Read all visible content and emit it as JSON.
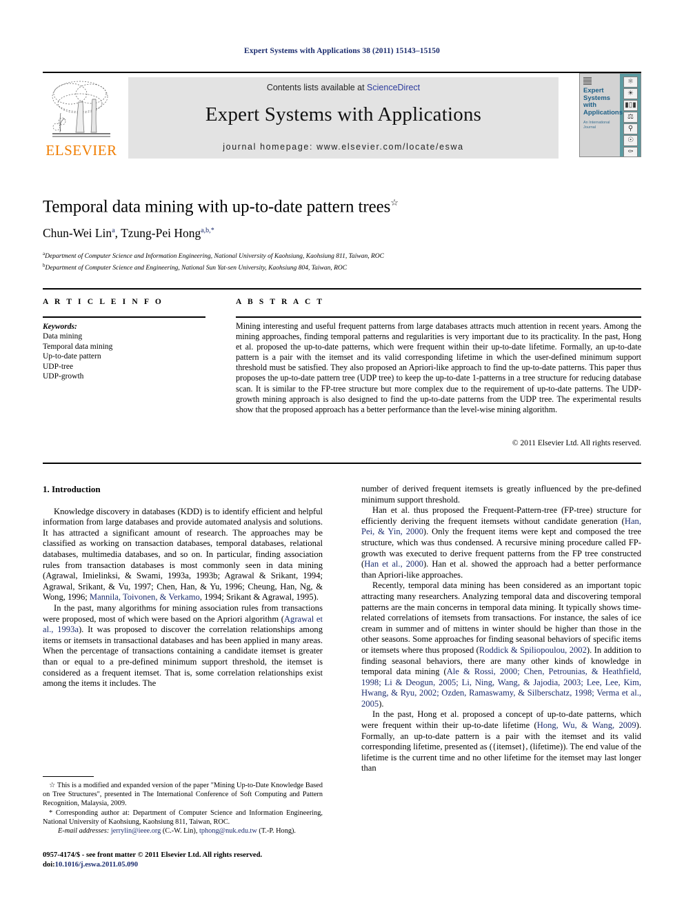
{
  "running_head": "Expert Systems with Applications 38 (2011) 15143–15150",
  "banner": {
    "contents_prefix": "Contents lists available at ",
    "sciencedirect": "ScienceDirect",
    "journal_title": "Expert Systems with Applications",
    "homepage_prefix": "journal homepage: ",
    "homepage_url": "www.elsevier.com/locate/eswa",
    "publisher": "ELSEVIER",
    "publisher_color": "#f07d00",
    "link_color": "#2b3a9c",
    "cover": {
      "name_line1": "Expert",
      "name_line2": "Systems",
      "name_line3": "with",
      "name_line4": "Applications",
      "subtitle_line1": "An International",
      "subtitle_line2": "Journal",
      "strip_color": "#5c9aa0",
      "icons": [
        "atom-icon",
        "globe-icon",
        "bar-chart-icon",
        "scales-icon",
        "document-icon",
        "microscope-icon",
        "network-icon",
        "flask-icon",
        "antenna-icon"
      ]
    }
  },
  "article": {
    "title": "Temporal data mining with up-to-date pattern trees",
    "title_footnote_marker": "☆",
    "authors": "Chun-Wei Lin",
    "author1_sup": "a",
    "author2": ", Tzung-Pei Hong",
    "author2_sup": "a,b,",
    "author2_star": "*",
    "affiliation_a_marker": "a",
    "affiliation_a": "Department of Computer Science and Information Engineering, National University of Kaohsiung, Kaohsiung 811, Taiwan, ROC",
    "affiliation_b_marker": "b",
    "affiliation_b": "Department of Computer Science and Engineering, National Sun Yat-sen University, Kaohsiung 804, Taiwan, ROC"
  },
  "article_info": {
    "heading": "A R T I C L E  I N F O",
    "keywords_label": "Keywords:",
    "keywords": [
      "Data mining",
      "Temporal data mining",
      "Up-to-date pattern",
      "UDP-tree",
      "UDP-growth"
    ]
  },
  "abstract": {
    "heading": "A B S T R A C T",
    "text": "Mining interesting and useful frequent patterns from large databases attracts much attention in recent years. Among the mining approaches, finding temporal patterns and regularities is very important due to its practicality. In the past, Hong et al. proposed the up-to-date patterns, which were frequent within their up-to-date lifetime. Formally, an up-to-date pattern is a pair with the itemset and its valid corresponding lifetime in which the user-defined minimum support threshold must be satisfied. They also proposed an Apriori-like approach to find the up-to-date patterns. This paper thus proposes the up-to-date pattern tree (UDP tree) to keep the up-to-date 1-patterns in a tree structure for reducing database scan. It is similar to the FP-tree structure but more complex due to the requirement of up-to-date patterns. The UDP-growth mining approach is also designed to find the up-to-date patterns from the UDP tree. The experimental results show that the proposed approach has a better performance than the level-wise mining algorithm.",
    "copyright": "© 2011 Elsevier Ltd. All rights reserved."
  },
  "body": {
    "section_heading": "1. Introduction",
    "left_paragraphs": [
      {
        "segments": [
          {
            "t": "Knowledge discovery in databases (KDD) is to identify efficient and helpful information from large databases and provide automated analysis and solutions. It has attracted a significant amount of research. The approaches may be classified as working on transaction databases, temporal databases, relational databases, multimedia databases, and so on. In particular, finding association rules from transaction databases is most commonly seen in data mining (Agrawal, Imielinksi, & Swami, 1993a, 1993b; Agrawal & Srikant, 1994; Agrawal, Srikant, & Vu, 1997; Chen, Han, & Yu, 1996; Cheung, Han, Ng, & Wong, 1996; ",
            "ref": false
          },
          {
            "t": "Mannila, Toivonen, & Verkamo",
            "ref": true
          },
          {
            "t": ", 1994; Srikant & Agrawal, 1995).",
            "ref": false
          }
        ]
      },
      {
        "segments": [
          {
            "t": "In the past, many algorithms for mining association rules from transactions were proposed, most of which were based on the Apriori algorithm (",
            "ref": false
          },
          {
            "t": "Agrawal et al., 1993a",
            "ref": true
          },
          {
            "t": "). It was proposed to discover the correlation relationships among items or itemsets in transactional databases and has been applied in many areas. When the percentage of transactions containing a candidate itemset is greater than or equal to a pre-defined minimum support threshold, the itemset is considered as a frequent itemset. That is, some correlation relationships exist among the items it includes. The",
            "ref": false
          }
        ]
      }
    ],
    "right_paragraphs": [
      {
        "no_indent": true,
        "segments": [
          {
            "t": "number of derived frequent itemsets is greatly influenced by the pre-defined minimum support threshold.",
            "ref": false
          }
        ]
      },
      {
        "segments": [
          {
            "t": "Han et al. thus proposed the Frequent-Pattern-tree (FP-tree) structure for efficiently deriving the frequent itemsets without candidate generation (",
            "ref": false
          },
          {
            "t": "Han, Pei, & Yin, 2000",
            "ref": true
          },
          {
            "t": "). Only the frequent items were kept and composed the tree structure, which was thus condensed. A recursive mining procedure called FP-growth was executed to derive frequent patterns from the FP tree constructed (",
            "ref": false
          },
          {
            "t": "Han et al., 2000",
            "ref": true
          },
          {
            "t": "). Han et al. showed the approach had a better performance than Apriori-like approaches.",
            "ref": false
          }
        ]
      },
      {
        "segments": [
          {
            "t": "Recently, temporal data mining has been considered as an important topic attracting many researchers. Analyzing temporal data and discovering temporal patterns are the main concerns in temporal data mining. It typically shows time-related correlations of itemsets from transactions. For instance, the sales of ice cream in summer and of mittens in winter should be higher than those in the other seasons. Some approaches for finding seasonal behaviors of specific items or itemsets where thus proposed (",
            "ref": false
          },
          {
            "t": "Roddick & Spiliopoulou, 2002",
            "ref": true
          },
          {
            "t": "). In addition to finding seasonal behaviors, there are many other kinds of knowledge in temporal data mining (",
            "ref": false
          },
          {
            "t": "Ale & Rossi, 2000; Chen, Petrounias, & Heathfield, 1998; Li & Deogun, 2005; Li, Ning, Wang, & Jajodia, 2003; Lee, Lee, Kim, Hwang, & Ryu, 2002; Ozden, Ramaswamy, & Silberschatz, 1998; Verma et al., 2005",
            "ref": true
          },
          {
            "t": ").",
            "ref": false
          }
        ]
      },
      {
        "segments": [
          {
            "t": "In the past, Hong et al. proposed a concept of up-to-date patterns, which were frequent within their up-to-date lifetime (",
            "ref": false
          },
          {
            "t": "Hong, Wu, & Wang, 2009",
            "ref": true
          },
          {
            "t": "). Formally, an up-to-date pattern is a pair with the itemset and its valid corresponding lifetime, presented as ({itemset}, (lifetime)). The end value of the lifetime is the current time and no other lifetime for the itemset may last longer than",
            "ref": false
          }
        ]
      }
    ]
  },
  "footnotes": {
    "star_note": "☆ This is a modified and expanded version of the paper \"Mining Up-to-Date Knowledge Based on Tree Structures\", presented in The International Conference of Soft Computing and Pattern Recognition, Malaysia, 2009.",
    "corresponding_note": "* Corresponding author at: Department of Computer Science and Information Engineering, National University of Kaohsiung, Kaohsiung 811, Taiwan, ROC.",
    "email_label": "E-mail addresses:",
    "email1": "jerrylin@ieee.org",
    "email1_who": " (C.-W. Lin), ",
    "email2": "tphong@nuk.edu.tw",
    "email2_who": " (T.-P. Hong)."
  },
  "imprint": {
    "line1": "0957-4174/$ - see front matter © 2011 Elsevier Ltd. All rights reserved.",
    "doi_label": "doi:",
    "doi_value": "10.1016/j.eswa.2011.05.090"
  }
}
